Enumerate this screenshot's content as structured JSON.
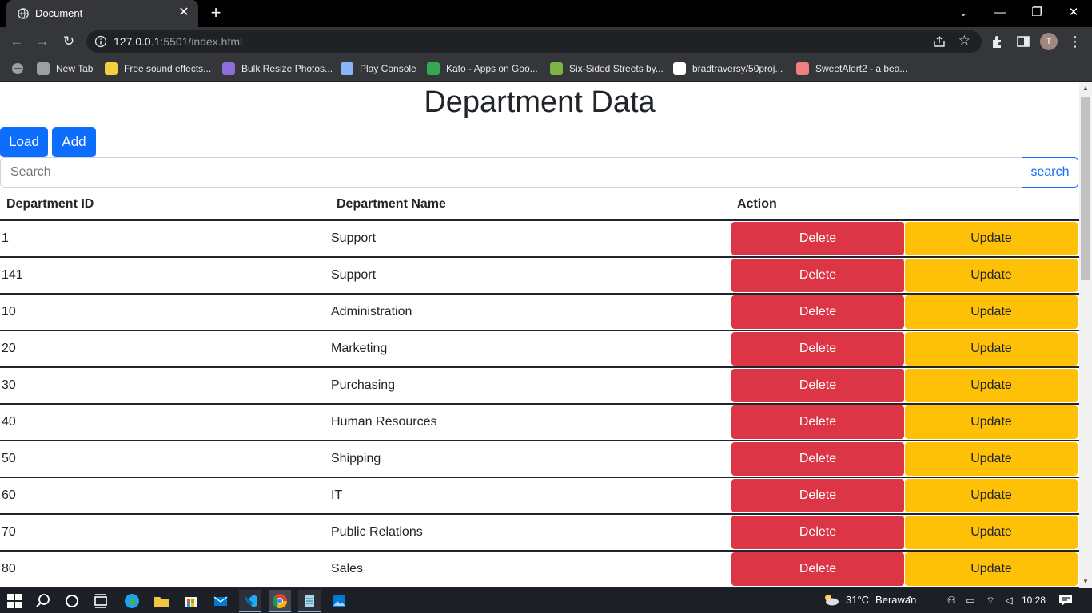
{
  "browser": {
    "tab_title": "Document",
    "tab_close": "✕",
    "new_tab": "+",
    "url_host": "127.0.0.1",
    "url_rest": ":5501/index.html",
    "avatar_initial": "T",
    "window_controls": {
      "minimize": "—",
      "restore": "❐",
      "close": "✕"
    },
    "bookmarks": [
      {
        "label": "New Tab",
        "icon": "globe-icon",
        "color": "#9aa0a6"
      },
      {
        "label": "Free sound effects...",
        "icon": "sound-effects-icon",
        "color": "#f4d03f"
      },
      {
        "label": "Bulk Resize Photos...",
        "icon": "resize-photos-icon",
        "color": "#8e6cd9"
      },
      {
        "label": "Play Console",
        "icon": "play-console-icon",
        "color": "#8ab4f8"
      },
      {
        "label": "Kato - Apps on Goo...",
        "icon": "google-play-icon",
        "color": "#34a853"
      },
      {
        "label": "Six-Sided Streets by...",
        "icon": "six-sided-streets-icon",
        "color": "#7cb342"
      },
      {
        "label": "bradtraversy/50proj...",
        "icon": "github-icon",
        "color": "#ffffff"
      },
      {
        "label": "SweetAlert2 - a bea...",
        "icon": "sweetalert-icon",
        "color": "#f08080"
      }
    ]
  },
  "page": {
    "title": "Department Data",
    "load_label": "Load",
    "add_label": "Add",
    "search_placeholder": "Search",
    "search_button": "search",
    "table": {
      "headers": [
        "Department ID",
        "Department Name",
        "Action"
      ],
      "delete_label": "Delete",
      "update_label": "Update",
      "rows": [
        {
          "id": "1",
          "name": "Support"
        },
        {
          "id": "141",
          "name": "Support"
        },
        {
          "id": "10",
          "name": "Administration"
        },
        {
          "id": "20",
          "name": "Marketing"
        },
        {
          "id": "30",
          "name": "Purchasing"
        },
        {
          "id": "40",
          "name": "Human Resources"
        },
        {
          "id": "50",
          "name": "Shipping"
        },
        {
          "id": "60",
          "name": "IT"
        },
        {
          "id": "70",
          "name": "Public Relations"
        },
        {
          "id": "80",
          "name": "Sales"
        }
      ]
    }
  },
  "taskbar": {
    "temperature": "31°C",
    "weather": "Berawan",
    "time": "10:28"
  },
  "colors": {
    "primary": "#0d6efd",
    "danger": "#dc3545",
    "warning": "#ffc107"
  }
}
